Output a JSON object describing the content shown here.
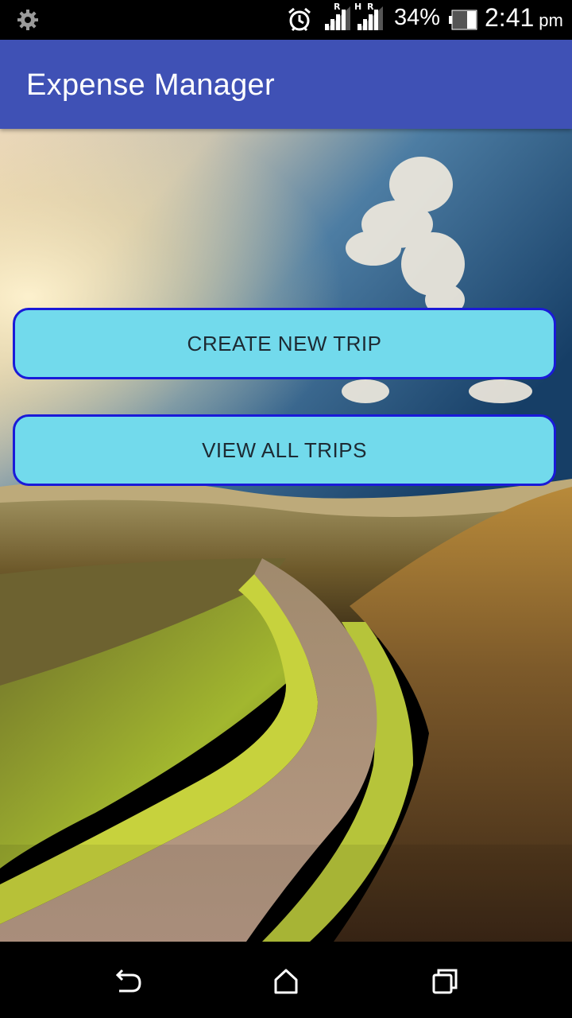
{
  "status_bar": {
    "network_label_1": "R",
    "network_label_2": "H",
    "network_label_3": "R",
    "battery_percent": "34%",
    "time": "2:41",
    "ampm": "pm",
    "icons": [
      "settings-icon",
      "alarm-icon",
      "signal-icon",
      "signal-icon",
      "battery-icon"
    ]
  },
  "app_bar": {
    "title": "Expense Manager",
    "color": "#3F51B5"
  },
  "main": {
    "buttons": {
      "create_new_trip": "CREATE NEW TRIP",
      "view_all_trips": "VIEW ALL TRIPS"
    },
    "button_color": "#72DAEC",
    "button_border_color": "#1A1AD8",
    "background_image": "country-road-landscape"
  },
  "nav_bar": {
    "icons": [
      "back-icon",
      "home-icon",
      "recents-icon"
    ]
  }
}
